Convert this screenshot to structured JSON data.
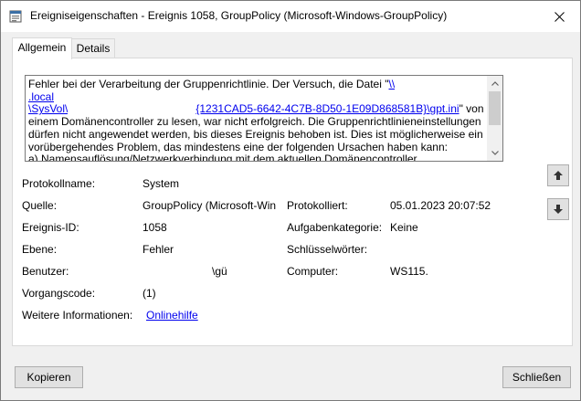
{
  "window": {
    "title": "Ereigniseigenschaften - Ereignis 1058, GroupPolicy (Microsoft-Windows-GroupPolicy)"
  },
  "tabs": [
    {
      "label": "Allgemein",
      "active": true
    },
    {
      "label": "Details",
      "active": false
    }
  ],
  "description": {
    "line1": "Fehler bei der Verarbeitung der Gruppenrichtlinie. Der Versuch, die Datei \"",
    "link_part1": "\\\\",
    "link_part2": ".local",
    "link_part3": "\\SysVol\\",
    "link_part4": "{1231CAD5-6642-4C7B-8D50-1E09D868581B}\\gpt.ini",
    "line2_end": "\" von",
    "rest": "einem Domänencontroller zu lesen, war nicht erfolgreich. Die Gruppenrichtlinieneinstellungen dürfen nicht angewendet werden, bis dieses Ereignis behoben ist. Dies ist möglicherweise ein vorübergehendes Problem, das mindestens eine der folgenden Ursachen haben kann:",
    "cause": "a) Namensauflösung/Netzwerkverbindung mit dem aktuellen Domänencontroller."
  },
  "fields": {
    "protokollname_label": "Protokollname:",
    "protokollname_value": "System",
    "quelle_label": "Quelle:",
    "quelle_value": "GroupPolicy (Microsoft-Win",
    "protokolliert_label": "Protokolliert:",
    "protokolliert_value": "05.01.2023 20:07:52",
    "ereignis_id_label": "Ereignis-ID:",
    "ereignis_id_value": "1058",
    "aufgabenkategorie_label": "Aufgabenkategorie:",
    "aufgabenkategorie_value": "Keine",
    "ebene_label": "Ebene:",
    "ebene_value": "Fehler",
    "schluesselwoerter_label": "Schlüsselwörter:",
    "schluesselwoerter_value": "",
    "benutzer_label": "Benutzer:",
    "benutzer_value": "\\gü",
    "computer_label": "Computer:",
    "computer_value": "WS115.",
    "vorgangscode_label": "Vorgangscode:",
    "vorgangscode_value": "(1)",
    "weitere_label": "Weitere Informationen:",
    "weitere_link": "Onlinehilfe"
  },
  "buttons": {
    "copy": "Kopieren",
    "close": "Schließen"
  },
  "icons": {
    "title": "event-viewer-icon",
    "close": "close-icon",
    "up": "arrow-up-icon",
    "down": "arrow-down-icon"
  }
}
